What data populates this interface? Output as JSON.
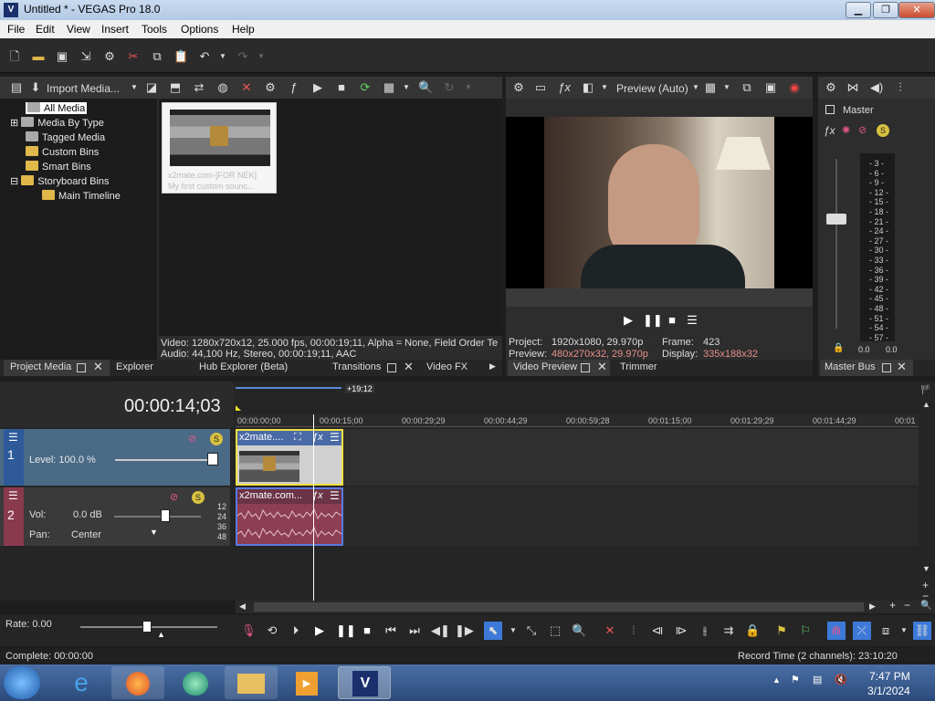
{
  "window": {
    "title": "Untitled * - VEGAS Pro 18.0",
    "app_icon_letter": "V"
  },
  "menu": [
    "File",
    "Edit",
    "View",
    "Insert",
    "Tools",
    "Options",
    "Help"
  ],
  "media_toolbar": {
    "import_label": "Import Media..."
  },
  "tree": {
    "all_media": "All Media",
    "media_by_type": "Media By Type",
    "tagged_media": "Tagged Media",
    "custom_bins": "Custom Bins",
    "smart_bins": "Smart Bins",
    "storyboard_bins": "Storyboard Bins",
    "main_timeline": "Main Timeline"
  },
  "media_item": {
    "caption1": "x2mate.com-[FOR NEK]",
    "caption2": "My first custom sounc..."
  },
  "media_info": {
    "video": "Video: 1280x720x12, 25.000 fps, 00:00:19;11, Alpha = None, Field Order Te",
    "audio": "Audio: 44,100 Hz, Stereo, 00:00:19;11, AAC"
  },
  "left_tabs": {
    "project_media": "Project Media",
    "explorer": "Explorer",
    "hub_explorer": "Hub Explorer (Beta)",
    "transitions": "Transitions",
    "video_fx": "Video FX"
  },
  "preview": {
    "mode": "Preview (Auto)",
    "project_label": "Project:",
    "project_value": "1920x1080, 29.970p",
    "preview_label": "Preview:",
    "preview_value": "480x270x32, 29.970p",
    "frame_label": "Frame:",
    "frame_value": "423",
    "display_label": "Display:",
    "display_value": "335x188x32"
  },
  "preview_tabs": {
    "video_preview": "Video Preview",
    "trimmer": "Trimmer"
  },
  "master": {
    "label": "Master",
    "scale": [
      "3",
      "6",
      "9",
      "12",
      "15",
      "18",
      "21",
      "24",
      "27",
      "30",
      "33",
      "36",
      "39",
      "42",
      "45",
      "48",
      "51",
      "54",
      "57"
    ],
    "readout_left": "0.0",
    "readout_right": "0.0",
    "tab": "Master Bus"
  },
  "timeline": {
    "timecode": "00:00:14;03",
    "loop_badge": "+19:12",
    "ruler": [
      "00:00:00;00",
      "00:00:15;00",
      "00:00:29;29",
      "00:00:44;29",
      "00:00:59;28",
      "00:01:15;00",
      "00:01:29;29",
      "00:01:44;29",
      "00:01"
    ],
    "track1": {
      "number": "1",
      "level": "Level: 100.0 %"
    },
    "track2": {
      "number": "2",
      "vol_label": "Vol:",
      "vol_value": "0.0 dB",
      "pan_label": "Pan:",
      "pan_value": "Center",
      "db_marks": [
        "12",
        "24",
        "36",
        "48"
      ]
    },
    "video_clip": "x2mate....",
    "audio_clip": "x2mate.com..."
  },
  "transport": {
    "rate": "Rate: 0.00"
  },
  "status": {
    "left": "Complete: 00:00:00",
    "right": "Record Time (2 channels): 23:10:20"
  },
  "taskbar": {
    "time": "7:47 PM",
    "date": "3/1/2024"
  }
}
